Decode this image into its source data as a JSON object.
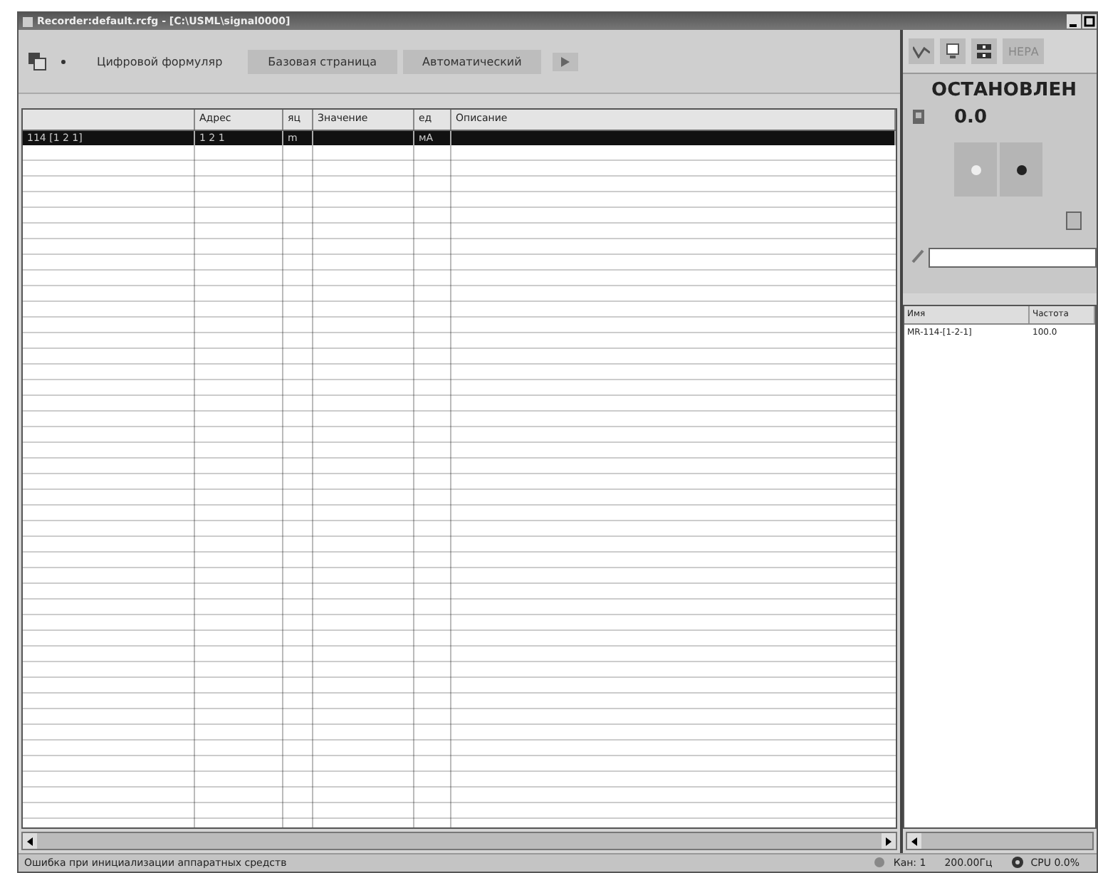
{
  "window": {
    "title": "Recorder:default.rcfg - [C:\\USML\\signal0000]"
  },
  "toolbar": {
    "tabs": [
      {
        "label": "Цифровой формуляр",
        "selected": true
      },
      {
        "label": "Базовая страница",
        "selected": false
      },
      {
        "label": "Автоматический",
        "selected": false
      }
    ]
  },
  "table": {
    "columns": [
      "",
      "Адрес",
      "яц",
      "Значение",
      "ед",
      "Описание"
    ],
    "rows": [
      {
        "cells": [
          "114 [1 2 1]",
          "1 2 1",
          "m",
          "",
          "мА",
          ""
        ],
        "selected": true
      }
    ]
  },
  "side_panel": {
    "button_label": "НЕРА",
    "state": "ОСТАНОВЛЕН",
    "reading": "0.0",
    "lamps": [
      {
        "on": false
      },
      {
        "on": true
      }
    ],
    "list": {
      "columns": [
        "Имя",
        "Частота"
      ],
      "rows": [
        {
          "cells": [
            "MR-114-[1-2-1]",
            "100.0"
          ],
          "selected": false
        }
      ]
    }
  },
  "status_bar": {
    "message": "Ошибка при инициализации аппаратных средств",
    "channel": "Кан: 1",
    "rate": "200.00Гц",
    "cpu": "CPU 0.0%"
  }
}
